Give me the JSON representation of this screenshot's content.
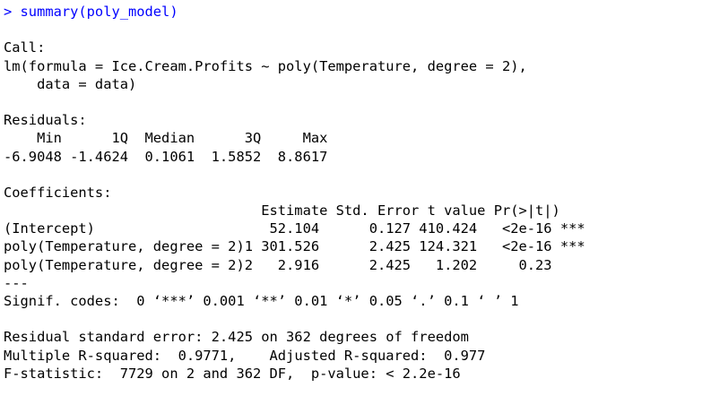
{
  "console": {
    "command_line": "> summary(poly_model)",
    "output_lines": [
      "",
      "Call:",
      "lm(formula = Ice.Cream.Profits ~ poly(Temperature, degree = 2),",
      "    data = data)",
      "",
      "Residuals:",
      "    Min      1Q  Median      3Q     Max ",
      "-6.9048 -1.4624  0.1061  1.5852  8.8617 ",
      "",
      "Coefficients:",
      "                               Estimate Std. Error t value Pr(>|t|)    ",
      "(Intercept)                     52.104      0.127 410.424   <2e-16 ***",
      "poly(Temperature, degree = 2)1 301.526      2.425 124.321   <2e-16 ***",
      "poly(Temperature, degree = 2)2   2.916      2.425   1.202     0.23    ",
      "---",
      "Signif. codes:  0 ‘***’ 0.001 ‘**’ 0.01 ‘*’ 0.05 ‘.’ 0.1 ‘ ’ 1",
      "",
      "Residual standard error: 2.425 on 362 degrees of freedom",
      "Multiple R-squared:  0.9771,\tAdjusted R-squared:  0.977 ",
      "F-statistic:  7729 on 2 and 362 DF,  p-value: < 2.2e-16"
    ]
  },
  "colors": {
    "command": "#0000ff",
    "output": "#000000",
    "background": "#ffffff"
  }
}
